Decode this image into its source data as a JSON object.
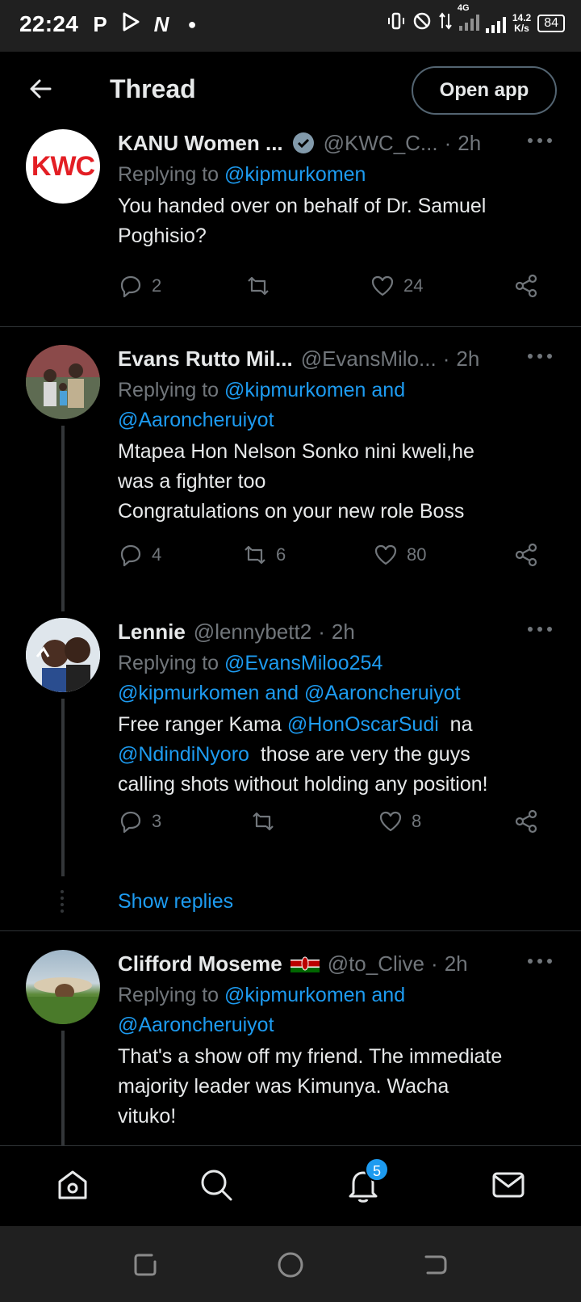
{
  "status_bar": {
    "time": "22:24",
    "left_icons": [
      "P",
      "N"
    ],
    "network": "4G",
    "speed_value": "14.2",
    "speed_unit": "K/s",
    "battery": "84"
  },
  "header": {
    "title": "Thread",
    "open_app_label": "Open app"
  },
  "tweets": [
    {
      "name": "KANU Women ...",
      "verified": true,
      "handle": "@KWC_C...",
      "time": "2h",
      "avatar_text": "KWC",
      "replying_prefix": "Replying to",
      "replying_mentions": "@kipmurkomen",
      "text_lines": [
        "You handed over on behalf of Dr. Samuel",
        "Poghisio?"
      ],
      "replies": "2",
      "retweets": "",
      "likes": "24"
    },
    {
      "name": "Evans Rutto Mil...",
      "handle": "@EvansMilo...",
      "time": "2h",
      "replying_prefix": "Replying to",
      "replying_line1": "@kipmurkomen and",
      "replying_line2": "@Aaroncheruiyot",
      "text_lines": [
        "Mtapea Hon Nelson Sonko nini kweli,he",
        "was a fighter too",
        "Congratulations on your new role Boss"
      ],
      "replies": "4",
      "retweets": "6",
      "likes": "80"
    },
    {
      "name": "Lennie",
      "handle": "@lennybett2",
      "time": "2h",
      "replying_prefix": "Replying to",
      "replying_line1": "@EvansMiloo254",
      "replying_line2": "@kipmurkomen and @Aaroncheruiyot",
      "text_line1_pre": "Free ranger Kama ",
      "text_line1_mention": "@HonOscarSudi",
      "text_line1_post": "  na",
      "text_line2_mention": "@NdindiNyoro",
      "text_line2_post": "  those are very the guys",
      "text_line3": "calling shots without holding any position!",
      "replies": "3",
      "retweets": "",
      "likes": "8"
    },
    {
      "name": "Clifford Moseme",
      "handle": "@to_Clive",
      "time": "2h",
      "replying_prefix": "Replying to",
      "replying_line1": "@kipmurkomen and",
      "replying_line2": "@Aaroncheruiyot",
      "text_lines": [
        "That's a show off my friend. The immediate",
        "majority leader was Kimunya. Wacha",
        "vituko!"
      ]
    }
  ],
  "show_replies_label": "Show replies",
  "bottom_nav": {
    "items": [
      "home-icon",
      "search-icon",
      "notifications-icon",
      "messages-icon"
    ],
    "notification_badge": "5"
  },
  "colors": {
    "accent": "#1d9bf0",
    "background": "#000000",
    "muted": "#71767b",
    "text": "#e7e9ea"
  }
}
